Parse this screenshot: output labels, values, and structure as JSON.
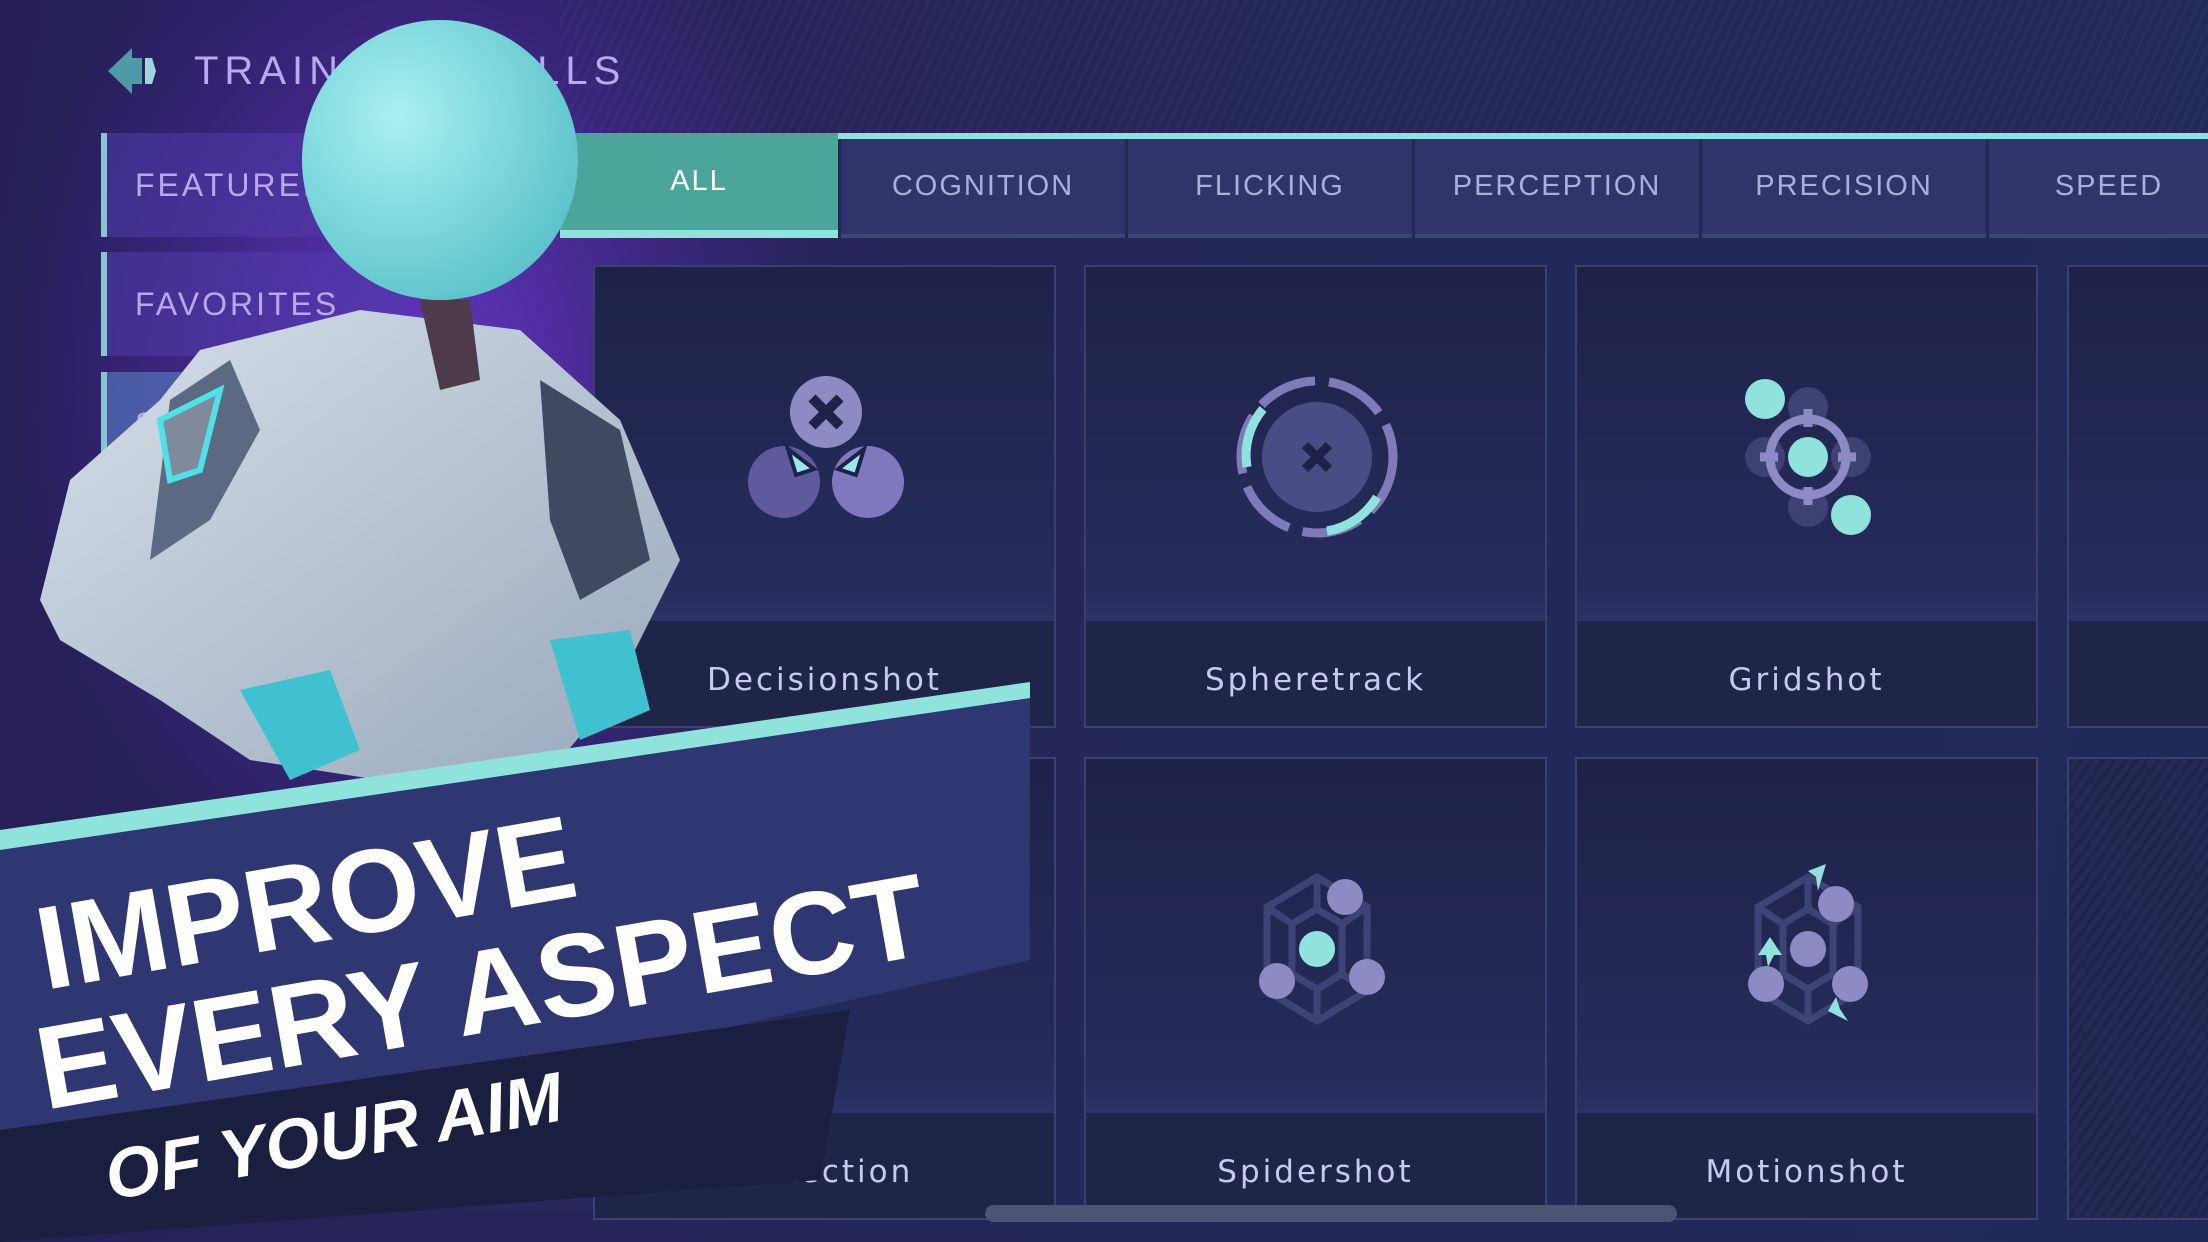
{
  "header": {
    "title": "TRAINING DRILLS",
    "back_icon": "back-arrow-icon"
  },
  "sidebar": {
    "items": [
      {
        "label": "FEATURED",
        "selected": false
      },
      {
        "label": "FAVORITES",
        "selected": false
      },
      {
        "label": "S",
        "selected": true
      }
    ]
  },
  "tabs": [
    {
      "label": "ALL",
      "active": true
    },
    {
      "label": "COGNITION",
      "active": false
    },
    {
      "label": "FLICKING",
      "active": false
    },
    {
      "label": "PERCEPTION",
      "active": false
    },
    {
      "label": "PRECISION",
      "active": false
    },
    {
      "label": "SPEED",
      "active": false
    }
  ],
  "drills": [
    {
      "name": "Decisionshot",
      "icon": "decisionshot-icon"
    },
    {
      "name": "Spheretrack",
      "icon": "spheretrack-icon"
    },
    {
      "name": "Gridshot",
      "icon": "gridshot-icon"
    },
    {
      "name": "",
      "icon": ""
    },
    {
      "name": "Detection",
      "icon": "detection-icon"
    },
    {
      "name": "Spidershot",
      "icon": "spidershot-icon"
    },
    {
      "name": "Motionshot",
      "icon": "motionshot-icon"
    },
    {
      "name": "",
      "icon": ""
    }
  ],
  "promo": {
    "line1": "IMPROVE",
    "line2": "EVERY ASPECT",
    "line3": "OF YOUR AIM"
  },
  "colors": {
    "accent": "#8fe3dc",
    "active_tab": "#4ba59b",
    "tab_bg": "#30346a",
    "icon_lilac": "#8e8bc4"
  }
}
